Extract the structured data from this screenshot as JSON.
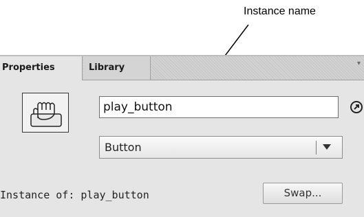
{
  "callout": {
    "label": "Instance name"
  },
  "tabs": [
    {
      "label": "Properties",
      "active": true
    },
    {
      "label": "Library",
      "active": false
    }
  ],
  "symbol": {
    "icon": "button-hand-icon"
  },
  "instance_name": {
    "value": "play_button"
  },
  "symbol_type": {
    "selected": "Button"
  },
  "instance_of": {
    "label": "Instance of:",
    "value": "play_button",
    "text": "Instance of: play_button"
  },
  "swap_button": {
    "label": "Swap..."
  },
  "colors": {
    "panel_bg": "#e5e5e5",
    "border": "#9f9f9f",
    "input_bg": "#ffffff"
  }
}
